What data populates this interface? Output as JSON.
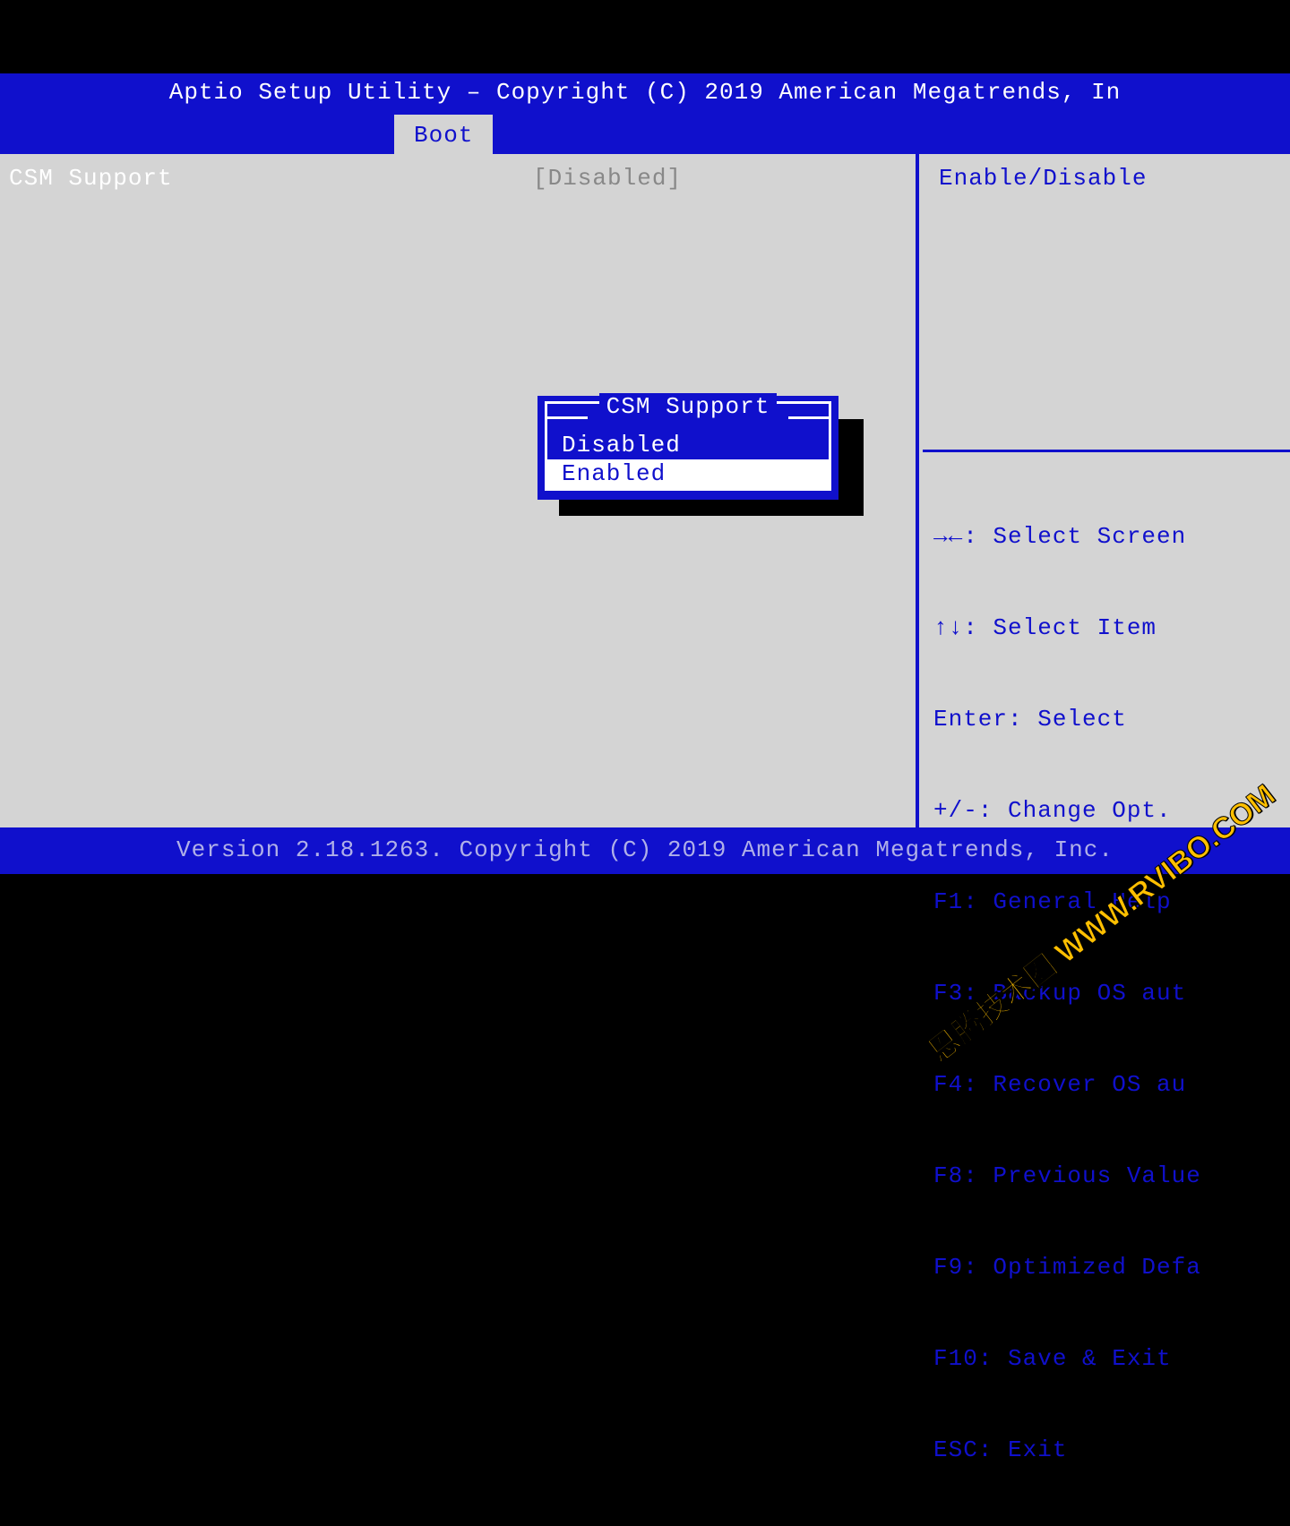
{
  "header": {
    "title": "Aptio Setup Utility – Copyright (C) 2019 American Megatrends, In",
    "active_tab": "Boot"
  },
  "main": {
    "setting_label": "CSM Support",
    "setting_value": "[Disabled]"
  },
  "popup": {
    "title": "CSM Support",
    "options": [
      "Disabled",
      "Enabled"
    ],
    "selected_index": 1
  },
  "help": {
    "description": "Enable/Disable",
    "keys": [
      "→←: Select Screen",
      "↑↓: Select Item",
      "Enter: Select",
      "+/-: Change Opt.",
      "F1: General Help",
      "F3: Backup OS aut",
      "F4: Recover OS au",
      "F8: Previous Value",
      "F9: Optimized Defa",
      "F10: Save & Exit",
      "ESC: Exit"
    ]
  },
  "footer": {
    "text": "Version 2.18.1263. Copyright (C) 2019 American Megatrends, Inc."
  },
  "watermark": "恩腾技术圈 WWW.RVIBO.COM"
}
